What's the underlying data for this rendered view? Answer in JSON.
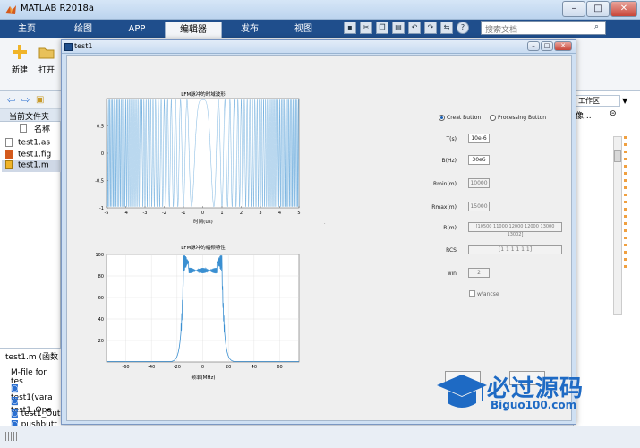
{
  "window": {
    "title": "MATLAB R2018a",
    "btn_min": "–",
    "btn_max": "□",
    "btn_close": "✕"
  },
  "ribbon_tabs": [
    "主页",
    "绘图",
    "APP",
    "编辑器",
    "发布",
    "视图"
  ],
  "search": {
    "placeholder": "搜索文档"
  },
  "ribbon": {
    "new_label": "新建",
    "open_label": "打开"
  },
  "left_panel": {
    "current_folder": "当前文件夹",
    "name_header": "名称",
    "files": [
      "test1.as",
      "test1.fig",
      "test1.m"
    ],
    "details_title": "test1.m  (函数",
    "details_desc": "M-file for tes",
    "functions": [
      "test1(vara",
      "test1_Ope",
      "test1_Out",
      "pushbutt"
    ]
  },
  "right_panel": {
    "label": "工作区",
    "truncated": "像..."
  },
  "dialog": {
    "title": "test1",
    "buttons": {
      "min": "–",
      "max": "□",
      "close": "✕"
    },
    "radio_creat": "Creat Button",
    "radio_processing": "Processing Button",
    "fields": [
      {
        "label": "T(s)",
        "value": "10e-6",
        "enabled": true
      },
      {
        "label": "B(Hz)",
        "value": "30e6",
        "enabled": true
      },
      {
        "label": "Rmin(m)",
        "value": "10000",
        "enabled": false
      },
      {
        "label": "Rmax(m)",
        "value": "15000",
        "enabled": false
      },
      {
        "label": "R(m)",
        "value": "[10500 11000 12000 12000 13000 13002]",
        "enabled": false
      },
      {
        "label": "RCS",
        "value": "[1 1 1 1 1 1]",
        "enabled": false
      },
      {
        "label": "win",
        "value": "2",
        "enabled": false
      }
    ],
    "checkbox_label": "w/ancse"
  },
  "chart_data": [
    {
      "type": "line",
      "title": "LFM脉冲的时域波形",
      "xlabel": "时间(us)",
      "ylabel": "",
      "xlim": [
        -5,
        5
      ],
      "ylim": [
        -1,
        1
      ],
      "xticks": [
        -5,
        -4,
        -3,
        -2,
        -1,
        0,
        1,
        2,
        3,
        4,
        5
      ],
      "yticks": [
        -1,
        -0.5,
        0,
        0.5
      ],
      "signal": {
        "T_us": 10,
        "B_MHz": 30,
        "component": "real"
      },
      "grid": false
    },
    {
      "type": "line",
      "title": "LFM脉冲的幅频特性",
      "xlabel": "频率(MHz)",
      "ylabel": "",
      "xlim": [
        -75,
        75
      ],
      "ylim": [
        0,
        100
      ],
      "xticks": [
        -60,
        -40,
        -20,
        0,
        20,
        40,
        60
      ],
      "yticks": [
        20,
        40,
        60,
        80,
        100
      ],
      "grid": true,
      "passband_MHz": [
        -15,
        15
      ],
      "passband_level": 85
    }
  ],
  "watermark": {
    "text_cn": "必过源码",
    "text_en": "Biguo100.com"
  },
  "colors": {
    "plot_line": "#3a8fd1",
    "ribbon_bar": "#1f4e8c",
    "watermark": "#1e6ac4"
  }
}
